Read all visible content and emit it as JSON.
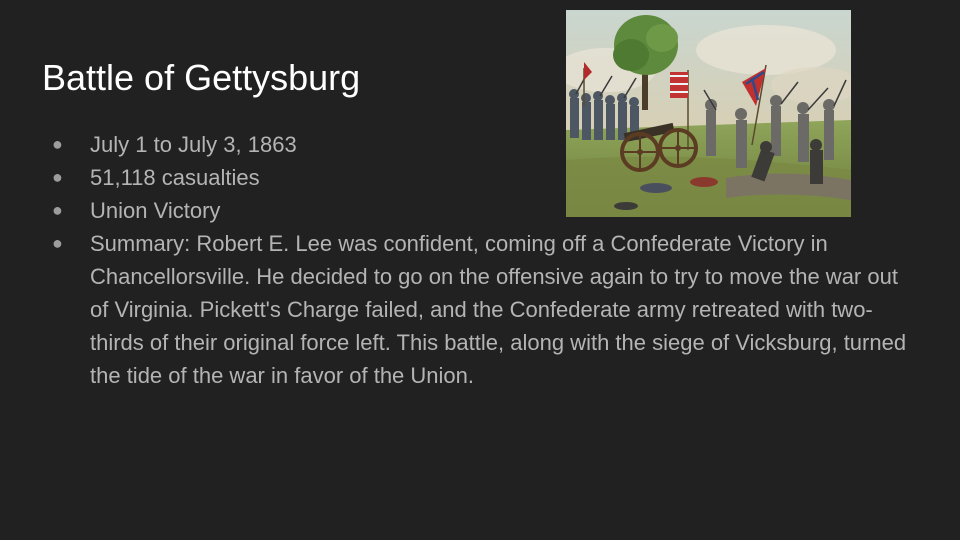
{
  "slide": {
    "title": "Battle of Gettysburg",
    "bullets": [
      "July 1 to July 3, 1863",
      "51,118 casualties",
      "Union Victory",
      "Summary: Robert E. Lee was confident, coming off a Confederate Victory in Chancellorsville. He decided to go on the offensive again to try to move the war out of Virginia. Pickett's Charge failed, and the Confederate army retreated with two-thirds of their original force left. This battle, along with the siege of Vicksburg, turned the tide of the war in favor of the Union."
    ],
    "bullet_glyph": "●",
    "image": "battle-painting"
  },
  "colors": {
    "background": "#212121",
    "title": "#ffffff",
    "body_text": "#b4b4b4"
  }
}
